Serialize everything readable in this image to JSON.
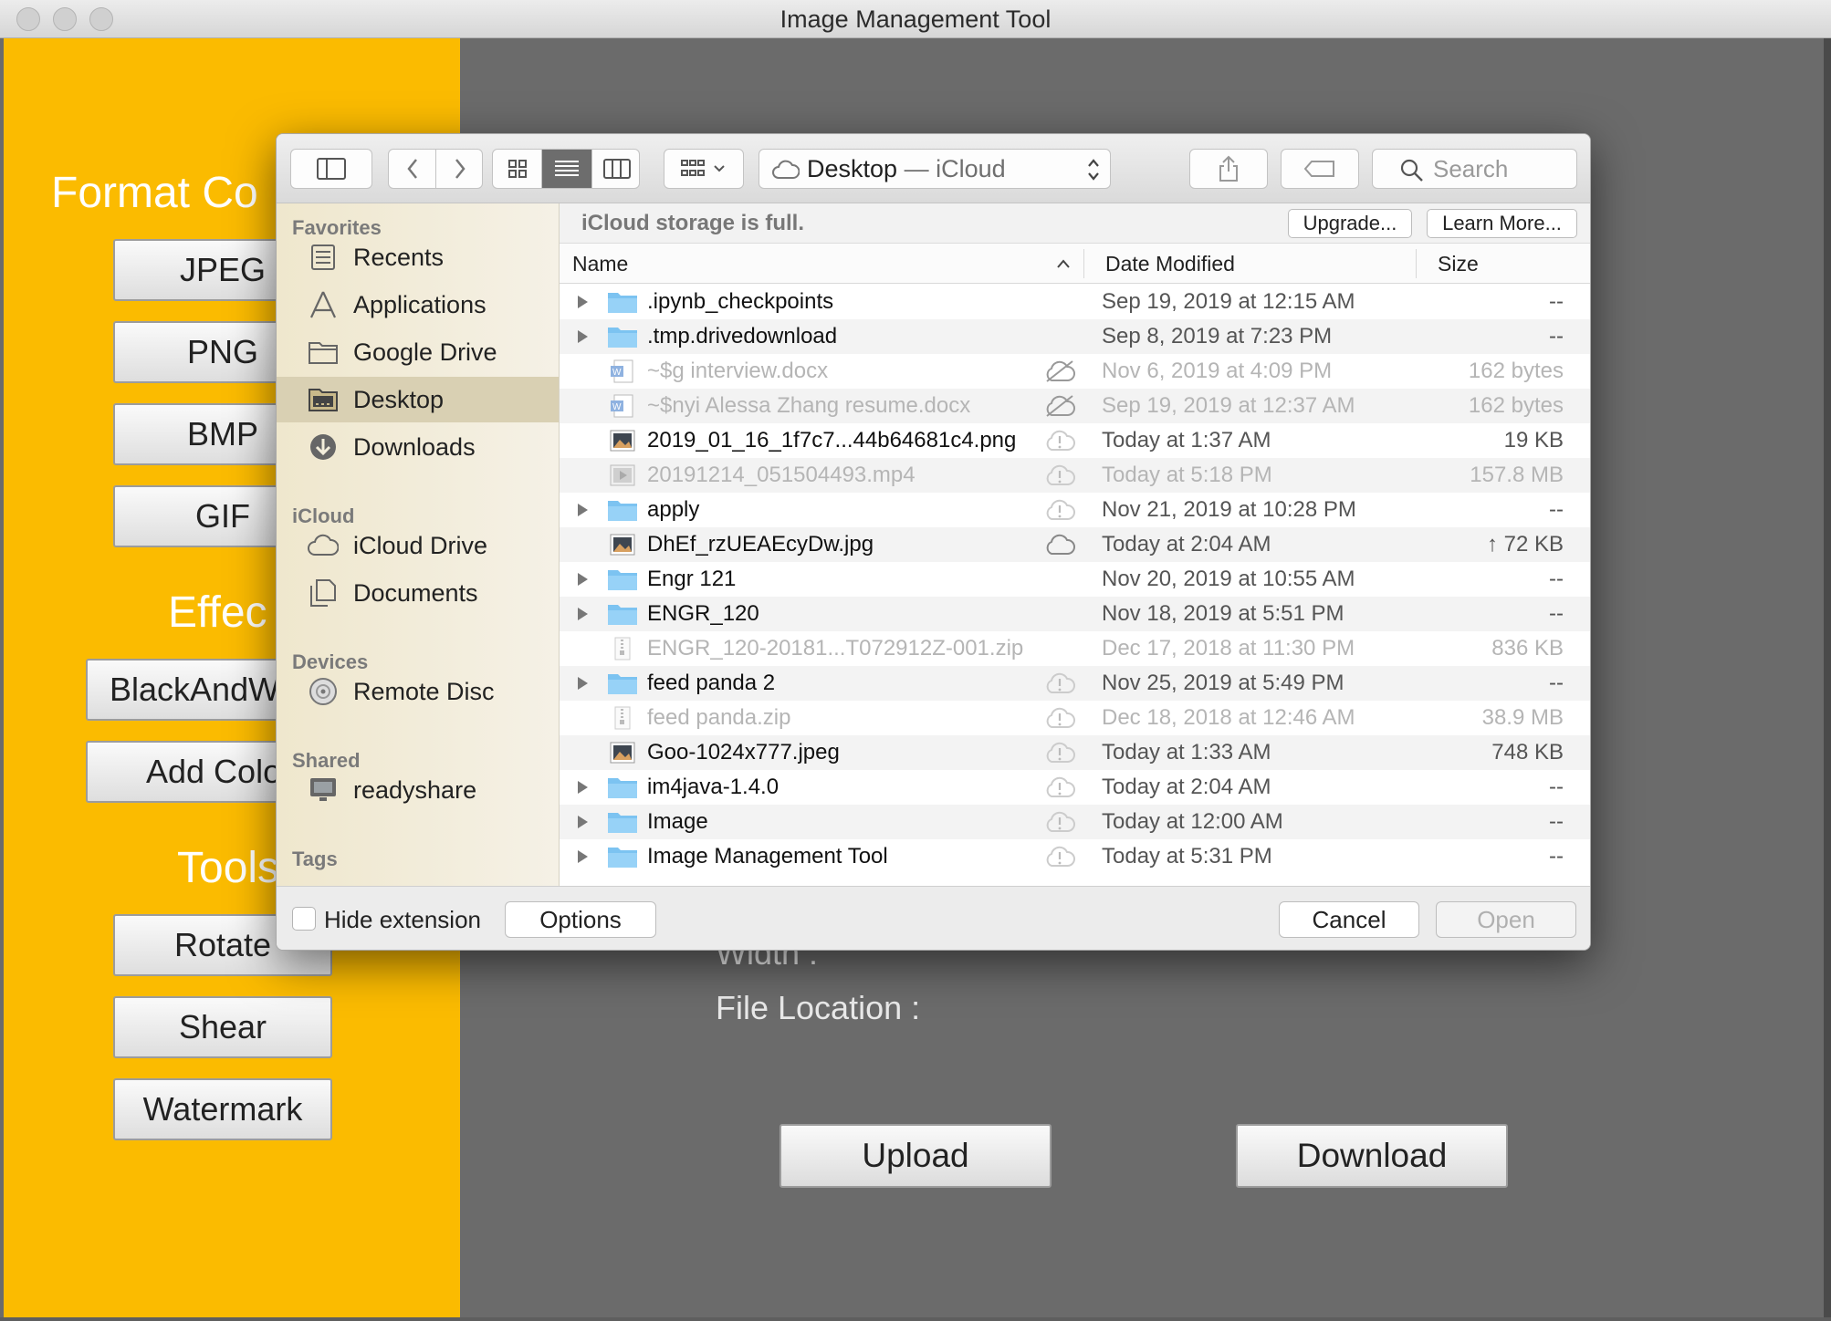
{
  "window": {
    "title": "Image Management Tool"
  },
  "left_panel": {
    "format_heading": "Format Co",
    "format_buttons": [
      "JPEG",
      "PNG",
      "BMP",
      "GIF"
    ],
    "effects_heading": "Effec",
    "effect_buttons": [
      "BlackAndW",
      "Add Colo"
    ],
    "tools_heading": "Tools",
    "tool_buttons": [
      "Rotate",
      "Shear",
      "Watermark"
    ]
  },
  "main_panel": {
    "width_label": "Width :",
    "file_location_label": "File Location :",
    "upload_label": "Upload",
    "download_label": "Download"
  },
  "dialog": {
    "location": {
      "folder": "Desktop",
      "separator": " — ",
      "service": "iCloud"
    },
    "search_placeholder": "Search",
    "sidebar": {
      "favorites_heading": "Favorites",
      "favorites": [
        {
          "label": "Recents",
          "icon": "recents-icon"
        },
        {
          "label": "Applications",
          "icon": "applications-icon"
        },
        {
          "label": "Google Drive",
          "icon": "folder-icon"
        },
        {
          "label": "Desktop",
          "icon": "desktop-icon",
          "selected": true
        },
        {
          "label": "Downloads",
          "icon": "downloads-icon"
        }
      ],
      "icloud_heading": "iCloud",
      "icloud": [
        {
          "label": "iCloud Drive",
          "icon": "cloud-icon"
        },
        {
          "label": "Documents",
          "icon": "documents-icon"
        }
      ],
      "devices_heading": "Devices",
      "devices": [
        {
          "label": "Remote Disc",
          "icon": "disc-icon"
        }
      ],
      "shared_heading": "Shared",
      "shared": [
        {
          "label": "readyshare",
          "icon": "monitor-icon"
        }
      ],
      "tags_heading": "Tags"
    },
    "notice": {
      "text": "iCloud storage is full.",
      "upgrade": "Upgrade...",
      "learn_more": "Learn More..."
    },
    "columns": {
      "name": "Name",
      "date": "Date Modified",
      "size": "Size"
    },
    "files": [
      {
        "name": ".ipynb_checkpoints",
        "date": "Sep 19, 2019 at 12:15 AM",
        "size": "--",
        "kind": "folder",
        "cloud": ""
      },
      {
        "name": ".tmp.drivedownload",
        "date": "Sep 8, 2019 at 7:23 PM",
        "size": "--",
        "kind": "folder",
        "cloud": ""
      },
      {
        "name": "~$g interview.docx",
        "date": "Nov 6, 2019 at 4:09 PM",
        "size": "162 bytes",
        "kind": "word",
        "cloud": "cloud-off-icon",
        "dim": true
      },
      {
        "name": "~$nyi Alessa Zhang resume.docx",
        "date": "Sep 19, 2019 at 12:37 AM",
        "size": "162 bytes",
        "kind": "word",
        "cloud": "cloud-off-icon",
        "dim": true
      },
      {
        "name": "2019_01_16_1f7c7...44b64681c4.png",
        "date": "Today at 1:37 AM",
        "size": "19 KB",
        "kind": "image",
        "cloud": "cloud-warning-icon"
      },
      {
        "name": "20191214_051504493.mp4",
        "date": "Today at 5:18 PM",
        "size": "157.8 MB",
        "kind": "video",
        "cloud": "cloud-warning-icon",
        "dim": true
      },
      {
        "name": "apply",
        "date": "Nov 21, 2019 at 10:28 PM",
        "size": "--",
        "kind": "folder",
        "cloud": "cloud-warning-icon"
      },
      {
        "name": "DhEf_rzUEAEcyDw.jpg",
        "date": "Today at 2:04 AM",
        "size": "↑ 72 KB",
        "kind": "image",
        "cloud": "cloud-icon"
      },
      {
        "name": "Engr 121",
        "date": "Nov 20, 2019 at 10:55 AM",
        "size": "--",
        "kind": "folder",
        "cloud": ""
      },
      {
        "name": "ENGR_120",
        "date": "Nov 18, 2019 at 5:51 PM",
        "size": "--",
        "kind": "folder",
        "cloud": ""
      },
      {
        "name": "ENGR_120-20181...T072912Z-001.zip",
        "date": "Dec 17, 2018 at 11:30 PM",
        "size": "836 KB",
        "kind": "zip",
        "cloud": "",
        "dim": true
      },
      {
        "name": "feed panda 2",
        "date": "Nov 25, 2019 at 5:49 PM",
        "size": "--",
        "kind": "folder",
        "cloud": "cloud-warning-icon"
      },
      {
        "name": "feed panda.zip",
        "date": "Dec 18, 2018 at 12:46 AM",
        "size": "38.9 MB",
        "kind": "zip",
        "cloud": "cloud-warning-icon",
        "dim": true
      },
      {
        "name": "Goo-1024x777.jpeg",
        "date": "Today at 1:33 AM",
        "size": "748 KB",
        "kind": "image",
        "cloud": "cloud-warning-icon"
      },
      {
        "name": "im4java-1.4.0",
        "date": "Today at 2:04 AM",
        "size": "--",
        "kind": "folder",
        "cloud": "cloud-warning-icon"
      },
      {
        "name": "Image",
        "date": "Today at 12:00 AM",
        "size": "--",
        "kind": "folder",
        "cloud": "cloud-warning-icon"
      },
      {
        "name": "Image Management Tool",
        "date": "Today at 5:31 PM",
        "size": "--",
        "kind": "folder",
        "cloud": "cloud-warning-icon"
      }
    ],
    "footer": {
      "hide_extension": "Hide extension",
      "options": "Options",
      "cancel": "Cancel",
      "open": "Open"
    }
  }
}
